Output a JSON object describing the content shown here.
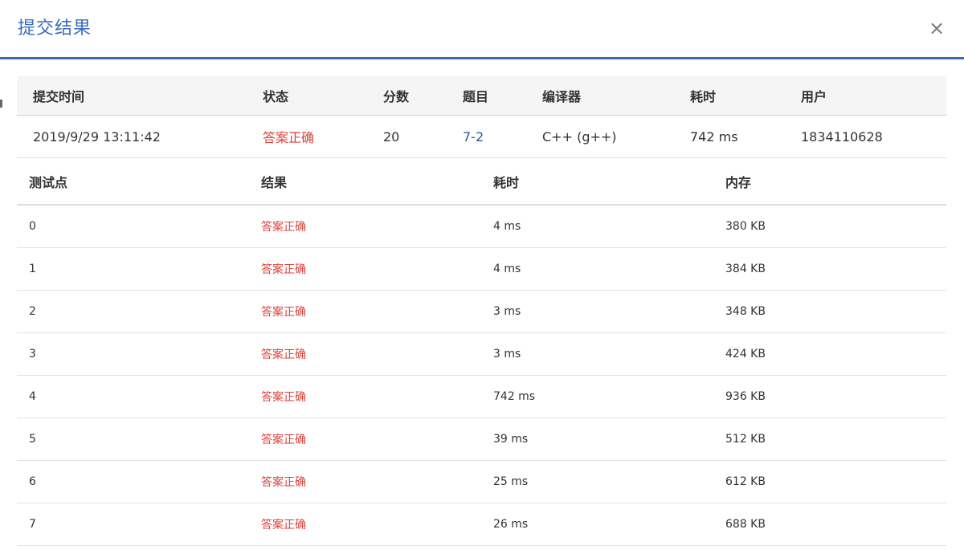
{
  "modal": {
    "title": "提交结果",
    "close_label": "×"
  },
  "summary": {
    "headers": [
      "提交时间",
      "状态",
      "分数",
      "题目",
      "编译器",
      "耗时",
      "用户"
    ],
    "row": {
      "time": "2019/9/29 13:11:42",
      "status": "答案正确",
      "score": "20",
      "problem": "7-2",
      "compiler": "C++ (g++)",
      "duration": "742 ms",
      "user": "1834110628"
    }
  },
  "testcases": {
    "headers": [
      "测试点",
      "结果",
      "耗时",
      "内存"
    ],
    "rows": [
      {
        "id": "0",
        "result": "答案正确",
        "time": "4 ms",
        "memory": "380 KB"
      },
      {
        "id": "1",
        "result": "答案正确",
        "time": "4 ms",
        "memory": "384 KB"
      },
      {
        "id": "2",
        "result": "答案正确",
        "time": "3 ms",
        "memory": "348 KB"
      },
      {
        "id": "3",
        "result": "答案正确",
        "time": "3 ms",
        "memory": "424 KB"
      },
      {
        "id": "4",
        "result": "答案正确",
        "time": "742 ms",
        "memory": "936 KB"
      },
      {
        "id": "5",
        "result": "答案正确",
        "time": "39 ms",
        "memory": "512 KB"
      },
      {
        "id": "6",
        "result": "答案正确",
        "time": "25 ms",
        "memory": "612 KB"
      },
      {
        "id": "7",
        "result": "答案正确",
        "time": "26 ms",
        "memory": "688 KB"
      }
    ]
  },
  "colors": {
    "accent": "#3f6bb5",
    "title": "#3a6cc0",
    "success": "#d9433c",
    "link": "#2c5a9c"
  }
}
